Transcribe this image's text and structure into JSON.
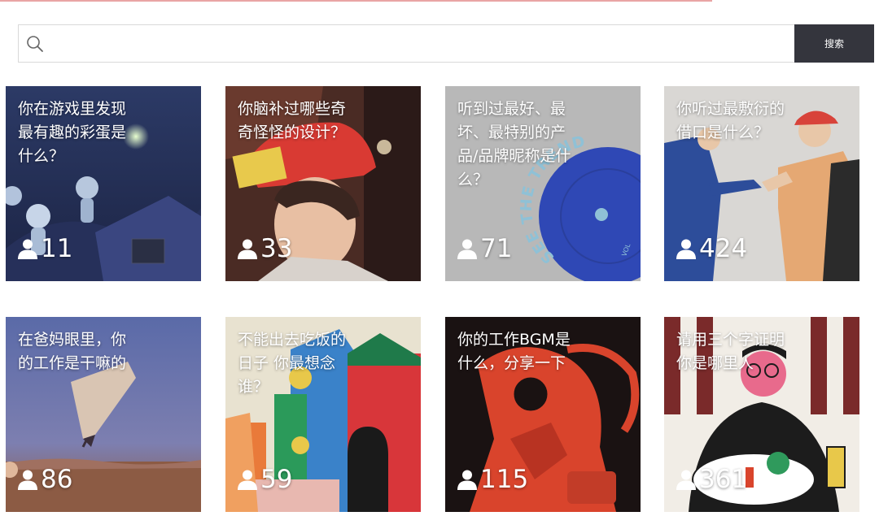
{
  "search": {
    "placeholder": "",
    "button_label": "搜索"
  },
  "icons": {
    "search": "search-icon",
    "participants": "user-icon"
  },
  "colors": {
    "top_line": "#e9a4a4",
    "search_button": "#34353d"
  },
  "cards": [
    {
      "title": "你在游戏里发现最有趣的彩蛋是什么？",
      "count": "11"
    },
    {
      "title": "你脑补过哪些奇奇怪怪的设计？",
      "count": "33"
    },
    {
      "title": "听到过最好、最坏、最特别的产品/品牌昵称是什么？",
      "count": "71",
      "art_text": "SEE THE TREND",
      "art_text_small": "VOL"
    },
    {
      "title": "你听过最敷衍的借口是什么？",
      "count": "424"
    },
    {
      "title": "在爸妈眼里，你的工作是干嘛的",
      "count": "86"
    },
    {
      "title": "不能出去吃饭的日子 你最想念谁？",
      "count": "59"
    },
    {
      "title": "你的工作BGM是什么，分享一下",
      "count": "115"
    },
    {
      "title": "请用三个字证明你是哪里人",
      "count": "361"
    }
  ]
}
